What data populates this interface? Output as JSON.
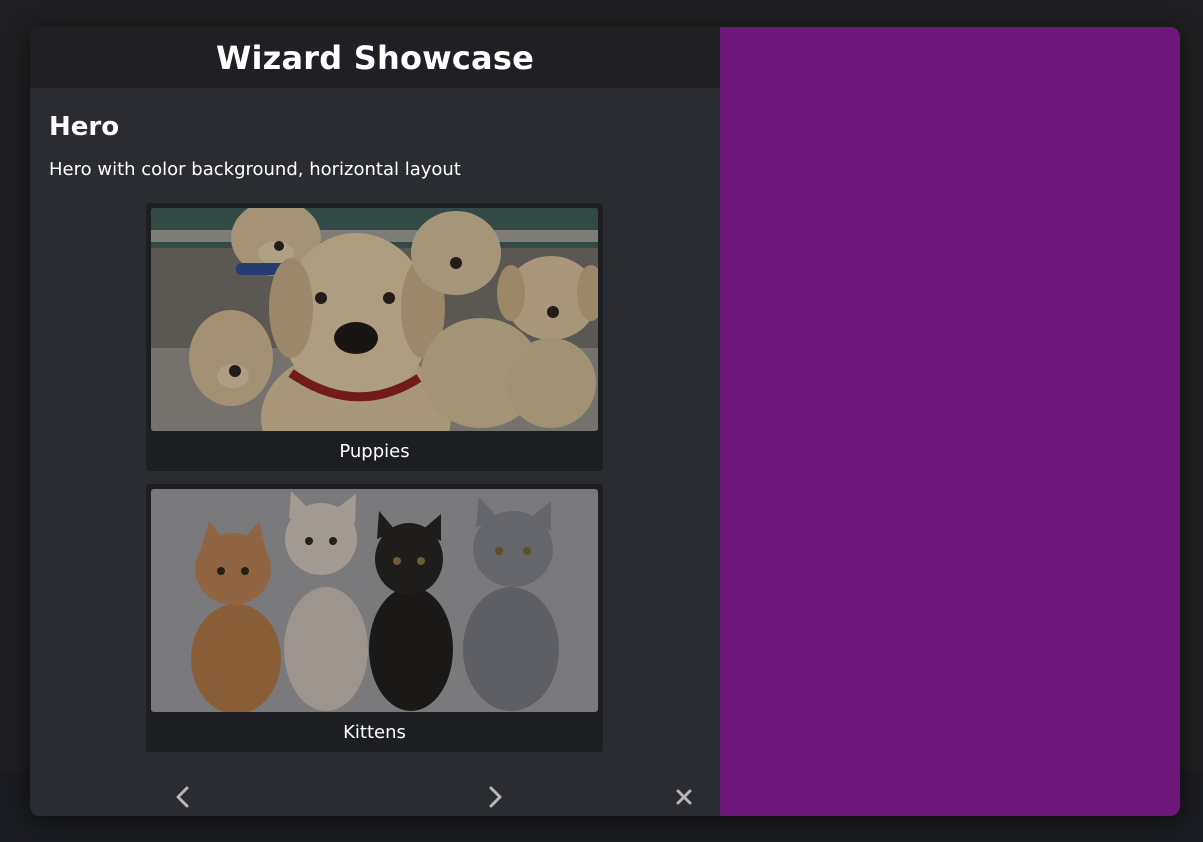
{
  "window": {
    "title": "Wizard Showcase"
  },
  "page": {
    "heading": "Hero",
    "description": "Hero with color background, horizontal layout"
  },
  "cards": [
    {
      "label": "Puppies",
      "image": "puppies-photo"
    },
    {
      "label": "Kittens",
      "image": "kittens-photo"
    }
  ],
  "footer": {
    "prev_icon": "chevron-left-icon",
    "next_icon": "chevron-right-icon",
    "close_icon": "close-icon"
  },
  "colors": {
    "hero_background": "#6d177b",
    "panel_background": "#2b2c31",
    "title_bar_background": "#202024",
    "card_background": "#1d1e22"
  }
}
